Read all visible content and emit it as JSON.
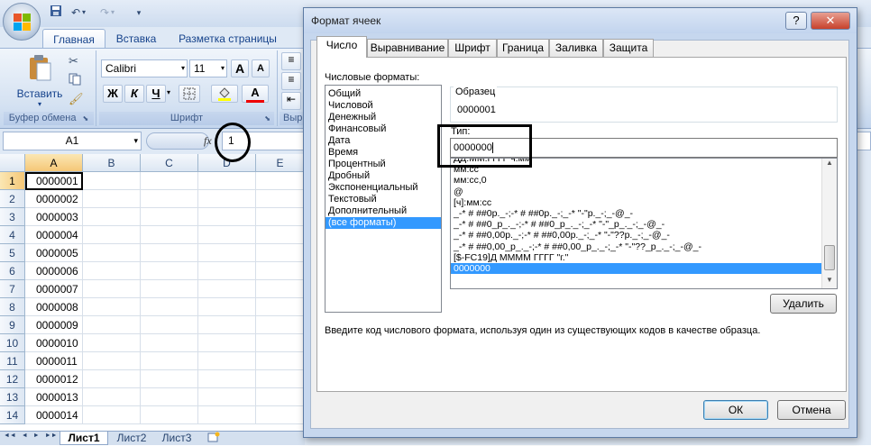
{
  "excel": {
    "ribbon_tabs": [
      "Главная",
      "Вставка",
      "Разметка страницы"
    ],
    "clipboard": {
      "paste_label": "Вставить",
      "group_label": "Буфер обмена"
    },
    "font": {
      "name": "Calibri",
      "size": "11",
      "bold": "Ж",
      "italic": "К",
      "underline": "Ч",
      "grow": "A",
      "shrink": "A",
      "group_label": "Шрифт"
    },
    "alignment_group_partial": "Выр",
    "name_box": "A1",
    "fx": "fx",
    "formula_value": "1",
    "columns": [
      "A",
      "B",
      "C",
      "D",
      "E"
    ],
    "rows": [
      "1",
      "2",
      "3",
      "4",
      "5",
      "6",
      "7",
      "8",
      "9",
      "10",
      "11",
      "12",
      "13",
      "14"
    ],
    "cells_a": [
      "0000001",
      "0000002",
      "0000003",
      "0000004",
      "0000005",
      "0000006",
      "0000007",
      "0000008",
      "0000009",
      "0000010",
      "0000011",
      "0000012",
      "0000013",
      "0000014"
    ],
    "sheet_tabs": [
      "Лист1",
      "Лист2",
      "Лист3"
    ],
    "sheet_nav": [
      "◄◄",
      "◄",
      "►",
      "►►"
    ]
  },
  "dialog": {
    "title": "Формат ячеек",
    "help": "?",
    "close": "✕",
    "tabs": [
      "Число",
      "Выравнивание",
      "Шрифт",
      "Граница",
      "Заливка",
      "Защита"
    ],
    "active_tab": "Число",
    "categories_label": "Числовые форматы:",
    "categories": [
      "Общий",
      "Числовой",
      "Денежный",
      "Финансовый",
      "Дата",
      "Время",
      "Процентный",
      "Дробный",
      "Экспоненциальный",
      "Текстовый",
      "Дополнительный",
      "(все форматы)"
    ],
    "selected_category": "(все форматы)",
    "sample_label": "Образец",
    "sample_value": "0000001",
    "type_label": "Тип:",
    "type_value": "0000000",
    "formats": [
      "ДД.ММ.ГГГГ ч:мм",
      "мм:сс",
      "мм:сс,0",
      "@",
      "[ч]:мм:сс",
      "_-* # ##0р._-;-* # ##0р._-;_-* \"-\"р._-;_-@_-",
      "_-* # ##0_р_._-;-* # ##0_р_._-;_-* \"-\"_р_._-;_-@_-",
      "_-* # ##0,00р._-;-* # ##0,00р._-;_-* \"-\"??р._-;_-@_-",
      "_-* # ##0,00_р_._-;-* # ##0,00_р_._-;_-* \"-\"??_р_._-;_-@_-",
      "[$-FC19]Д ММММ ГГГГ \"г.\"",
      "0000000"
    ],
    "delete_label": "Удалить",
    "hint": "Введите код числового формата, используя один из существующих кодов в качестве образца.",
    "ok_label": "ОК",
    "cancel_label": "Отмена"
  },
  "colors": {
    "selection": "#3399ff",
    "ribbon_text": "#15428b"
  }
}
